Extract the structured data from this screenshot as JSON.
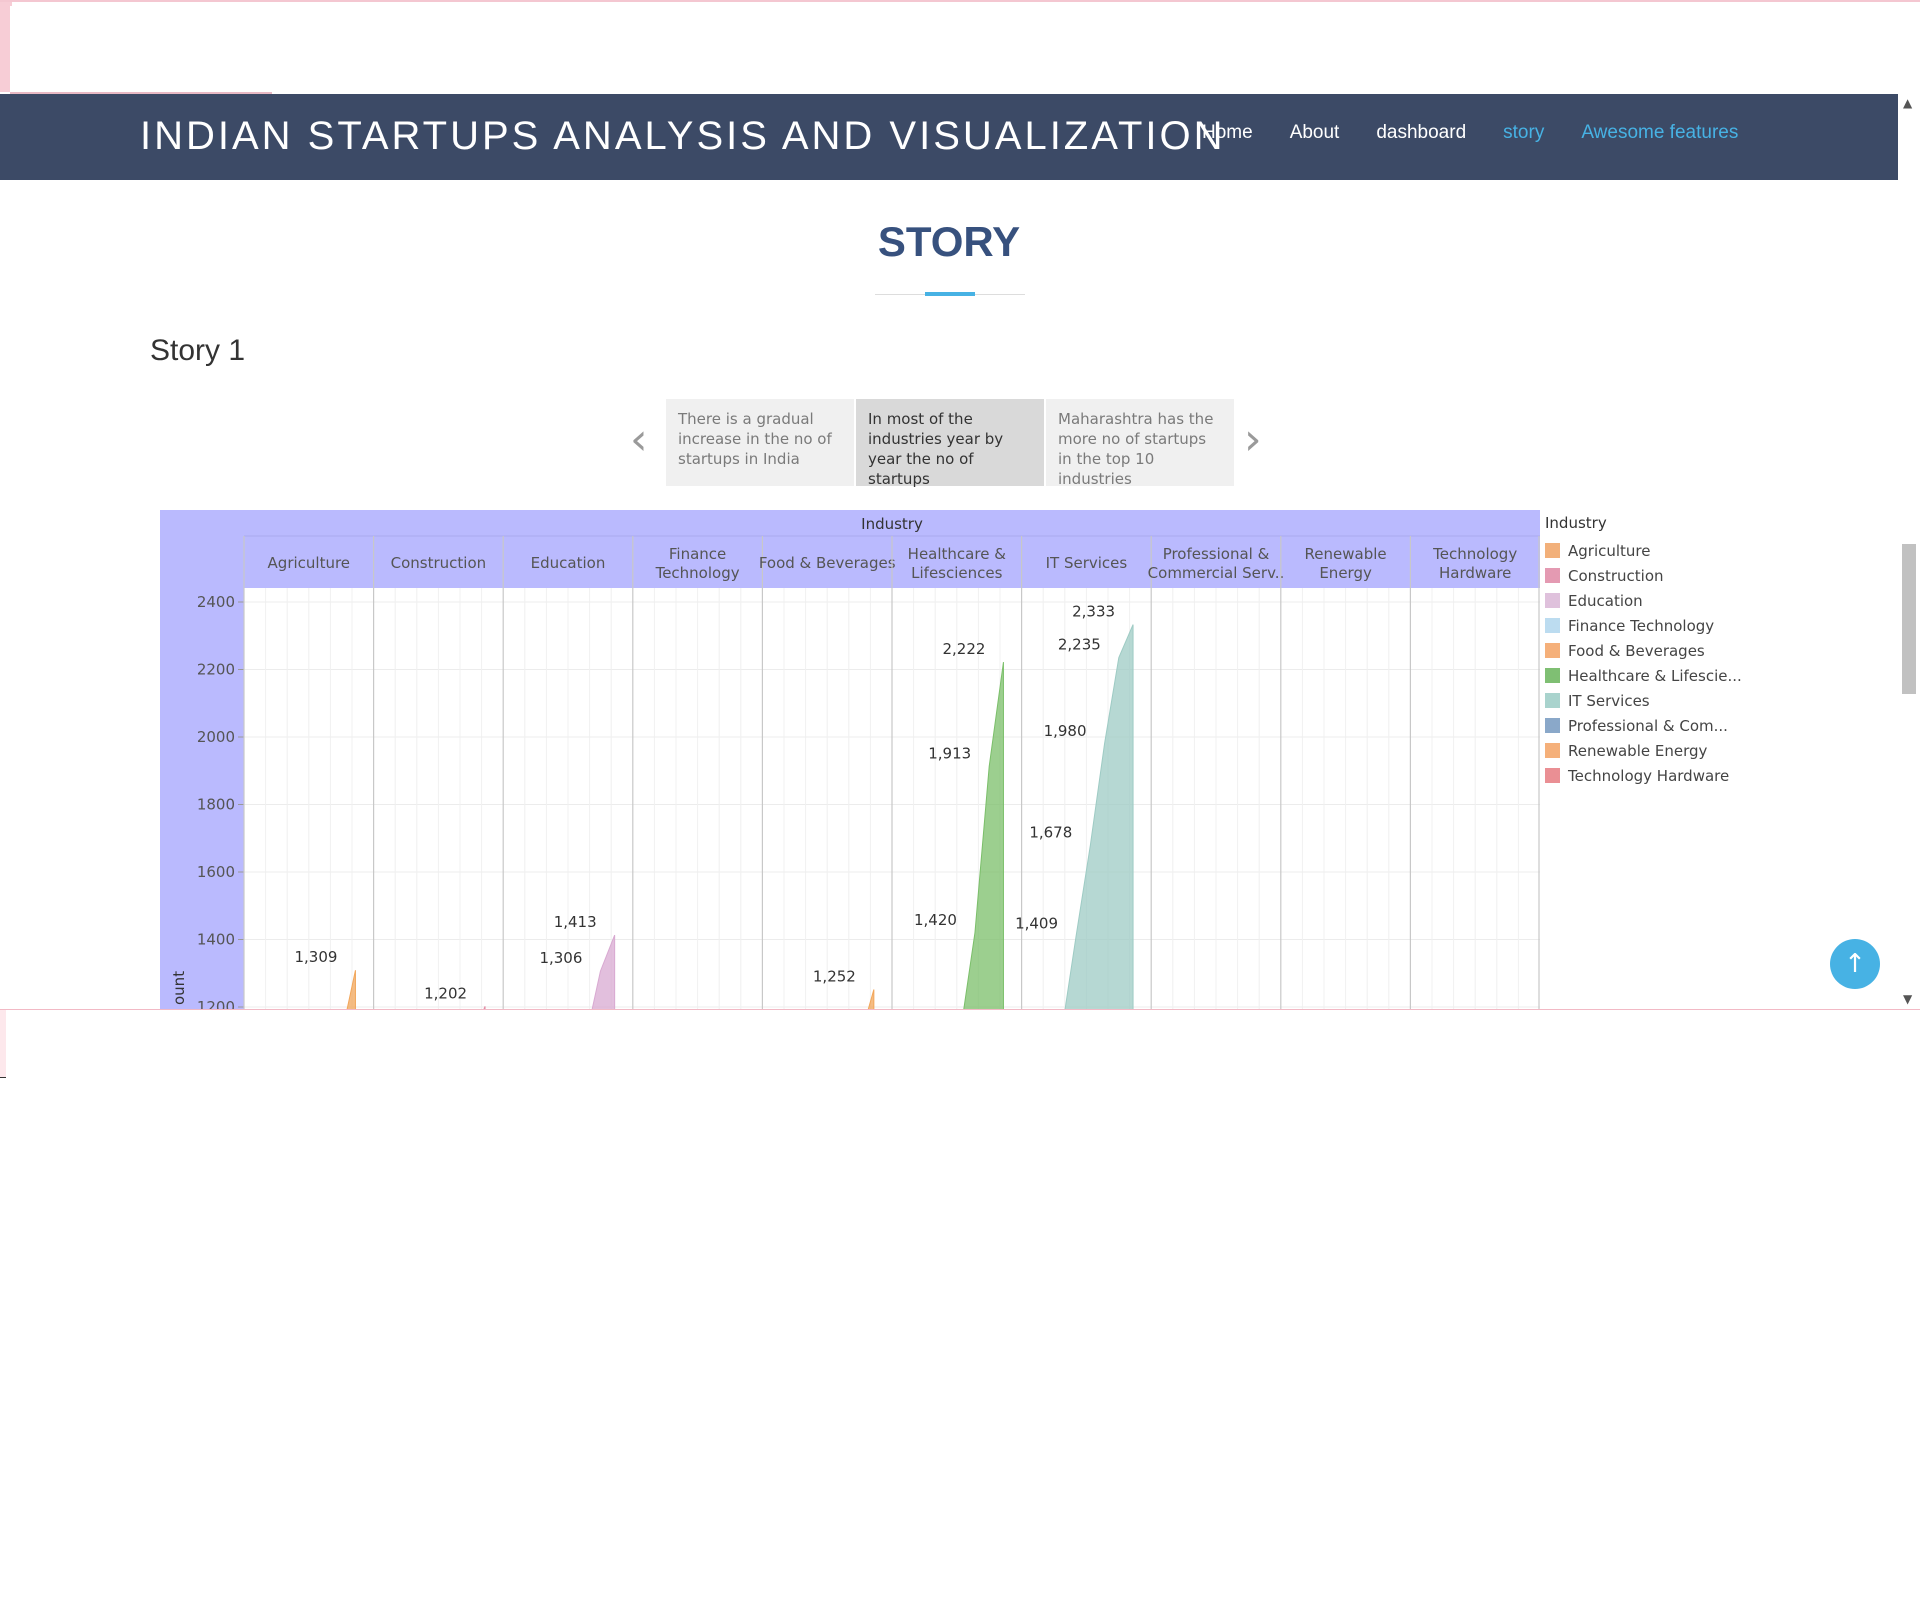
{
  "site": {
    "title": "INDIAN STARTUPS ANALYSIS AND VISUALIZATION",
    "nav": [
      "Home",
      "About",
      "dashboard",
      "story",
      "Awesome features"
    ]
  },
  "page": {
    "heading": "STORY",
    "story_label": "Story 1"
  },
  "story_points": [
    "There is a gradual increase in the no of startups in India",
    "In most of the industries year by year the no of startups",
    "Maharashtra has the more no of startups in the top 10 industries"
  ],
  "chart_data": {
    "type": "area",
    "column_header": "Industry",
    "y_axis_label": "ount",
    "y_ticks": [
      2400,
      2200,
      2000,
      1800,
      1600,
      1400,
      1200
    ],
    "ylim": [
      1200,
      2440
    ],
    "grid": true,
    "panels": [
      {
        "industry": "Agriculture",
        "header": "Agriculture",
        "color": "#f2a65a",
        "points": [
          {
            "value": 1309,
            "label": "1,309"
          }
        ]
      },
      {
        "industry": "Construction",
        "header": "Construction",
        "color": "#e08ea6",
        "points": [
          {
            "value": 1202,
            "label": "1,202"
          }
        ]
      },
      {
        "industry": "Education",
        "header": "Education",
        "color": "#d8a9d1",
        "points": [
          {
            "value": 1306,
            "label": "1,306"
          },
          {
            "value": 1413,
            "label": "1,413"
          }
        ]
      },
      {
        "industry": "Finance Technology",
        "header": "Finance Technology",
        "color": "#a9d0ea",
        "points": []
      },
      {
        "industry": "Food & Beverages",
        "header": "Food & Beverages",
        "color": "#f2a65a",
        "points": [
          {
            "value": 1252,
            "label": "1,252"
          }
        ]
      },
      {
        "industry": "Healthcare & Lifesciences",
        "header": "Healthcare & Lifesciences",
        "color": "#7bbf6a",
        "points": [
          {
            "value": 1420,
            "label": "1,420"
          },
          {
            "value": 1913,
            "label": "1,913"
          },
          {
            "value": 2222,
            "label": "2,222"
          }
        ]
      },
      {
        "industry": "IT Services",
        "header": "IT Services",
        "color": "#9ecbc4",
        "points": [
          {
            "value": 1409,
            "label": "1,409"
          },
          {
            "value": 1678,
            "label": "1,678"
          },
          {
            "value": 1980,
            "label": "1,980"
          },
          {
            "value": 2235,
            "label": "2,235"
          },
          {
            "value": 2333,
            "label": "2,333"
          }
        ]
      },
      {
        "industry": "Professional & Commercial Services",
        "header": "Professional & Commercial Serv..",
        "color": "#7f9cc2",
        "points": []
      },
      {
        "industry": "Renewable Energy",
        "header": "Renewable Energy",
        "color": "#f2a65a",
        "points": []
      },
      {
        "industry": "Technology Hardware",
        "header": "Technology Hardware",
        "color": "#e8898d",
        "points": []
      }
    ],
    "legend": {
      "title": "Industry",
      "items": [
        {
          "label": "Agriculture",
          "color": "#f2b07a"
        },
        {
          "label": "Construction",
          "color": "#e49ab2"
        },
        {
          "label": "Education",
          "color": "#dfc1dc"
        },
        {
          "label": "Finance Technology",
          "color": "#bcdcf0"
        },
        {
          "label": "Food & Beverages",
          "color": "#f5b07a"
        },
        {
          "label": "Healthcare & Lifescie...",
          "color": "#7fbf73"
        },
        {
          "label": "IT Services",
          "color": "#a9d3cd"
        },
        {
          "label": "Professional & Com...",
          "color": "#8aa8c9"
        },
        {
          "label": "Renewable Energy",
          "color": "#f5b07a"
        },
        {
          "label": "Technology Hardware",
          "color": "#ea8f94"
        }
      ]
    }
  },
  "colors": {
    "header_bg": "#3c4a66",
    "accent": "#47b2e4",
    "heading": "#37517e",
    "chart_header_bg": "#babafe"
  },
  "icons": {
    "prev": "chevron-left-icon",
    "next": "chevron-right-icon",
    "back_to_top": "arrow-up-icon"
  }
}
